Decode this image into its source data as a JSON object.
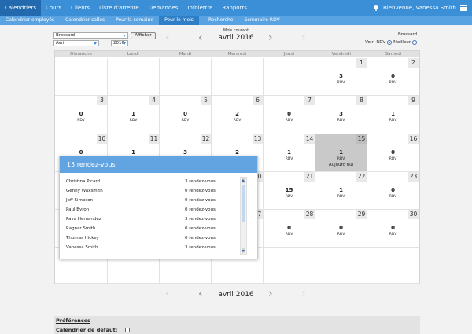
{
  "nav": {
    "tabs": [
      "Calendriers",
      "Cours",
      "Clients",
      "Liste d'attente",
      "Demandes",
      "Infolettre",
      "Rapports"
    ],
    "active": 0,
    "user": "Bienvenue, Vanessa Smith"
  },
  "subnav": {
    "tabs": [
      "Calendrier employés",
      "Calendrier salles",
      "Pour la semaine",
      "Pour le mois",
      "Recherche",
      "Sommaire RDV"
    ],
    "active": 3
  },
  "filters": {
    "employee": "Brossard",
    "month": "Avril",
    "year": "2016",
    "show_button": "Afficher"
  },
  "month_nav": {
    "current_label": "Mois courant",
    "title": "avril 2016"
  },
  "legend": {
    "location": "Brossard",
    "view_label": "Voir:",
    "option_rdv": "RDV",
    "option_better": "Meilleur",
    "selected": "RDV"
  },
  "calendar": {
    "weekdays": [
      "Dimanche",
      "Lundi",
      "Mardi",
      "Mercredi",
      "Jeudi",
      "Vendredi",
      "Samedi"
    ],
    "unit": "RDV",
    "today_label": "Aujourd'hui",
    "today": 15,
    "weeks": [
      [
        null,
        null,
        null,
        null,
        null,
        {
          "day": 1,
          "count": 3
        },
        {
          "day": 2,
          "count": 0
        }
      ],
      [
        {
          "day": 3,
          "count": 0
        },
        {
          "day": 4,
          "count": 1
        },
        {
          "day": 5,
          "count": 0
        },
        {
          "day": 6,
          "count": 2
        },
        {
          "day": 7,
          "count": 0
        },
        {
          "day": 8,
          "count": 3
        },
        {
          "day": 9,
          "count": 1
        }
      ],
      [
        {
          "day": 10,
          "count": 0
        },
        {
          "day": 11,
          "count": 1
        },
        {
          "day": 12,
          "count": 3
        },
        {
          "day": 13,
          "count": 2
        },
        {
          "day": 14,
          "count": 1
        },
        {
          "day": 15,
          "count": 1
        },
        {
          "day": 16,
          "count": 0
        }
      ],
      [
        {
          "day": 17,
          "count": null
        },
        {
          "day": 18,
          "count": null
        },
        {
          "day": 19,
          "count": null
        },
        {
          "day": 20,
          "count": null
        },
        {
          "day": 21,
          "count": 15
        },
        {
          "day": 22,
          "count": 1
        },
        {
          "day": 23,
          "count": 0
        }
      ],
      [
        {
          "day": 24,
          "count": null
        },
        {
          "day": 25,
          "count": null
        },
        {
          "day": 26,
          "count": null
        },
        {
          "day": 27,
          "count": null
        },
        {
          "day": 28,
          "count": 0
        },
        {
          "day": 29,
          "count": 0
        },
        {
          "day": 30,
          "count": 0
        }
      ],
      [
        null,
        null,
        null,
        null,
        null,
        null,
        null
      ]
    ]
  },
  "popup": {
    "title": "15 rendez-vous",
    "rows": [
      {
        "name": "Christina Picard",
        "count": "3 rendez-vous"
      },
      {
        "name": "Genny Waxsmith",
        "count": "0 rendez-vous"
      },
      {
        "name": "Jeff Simpson",
        "count": "0 rendez-vous"
      },
      {
        "name": "Paul Byron",
        "count": "0 rendez-vous"
      },
      {
        "name": "Pava Hernandez",
        "count": "3 rendez-vous"
      },
      {
        "name": "Ragnar Smith",
        "count": "0 rendez-vous"
      },
      {
        "name": "Thomas Hickey",
        "count": "0 rendez-vous"
      },
      {
        "name": "Vanessa Smith",
        "count": "3 rendez-vous"
      }
    ]
  },
  "bottom_nav": {
    "title": "avril 2016"
  },
  "preferences": {
    "title": "Préférences",
    "default_calendar_label": "Calendrier de défaut:"
  }
}
